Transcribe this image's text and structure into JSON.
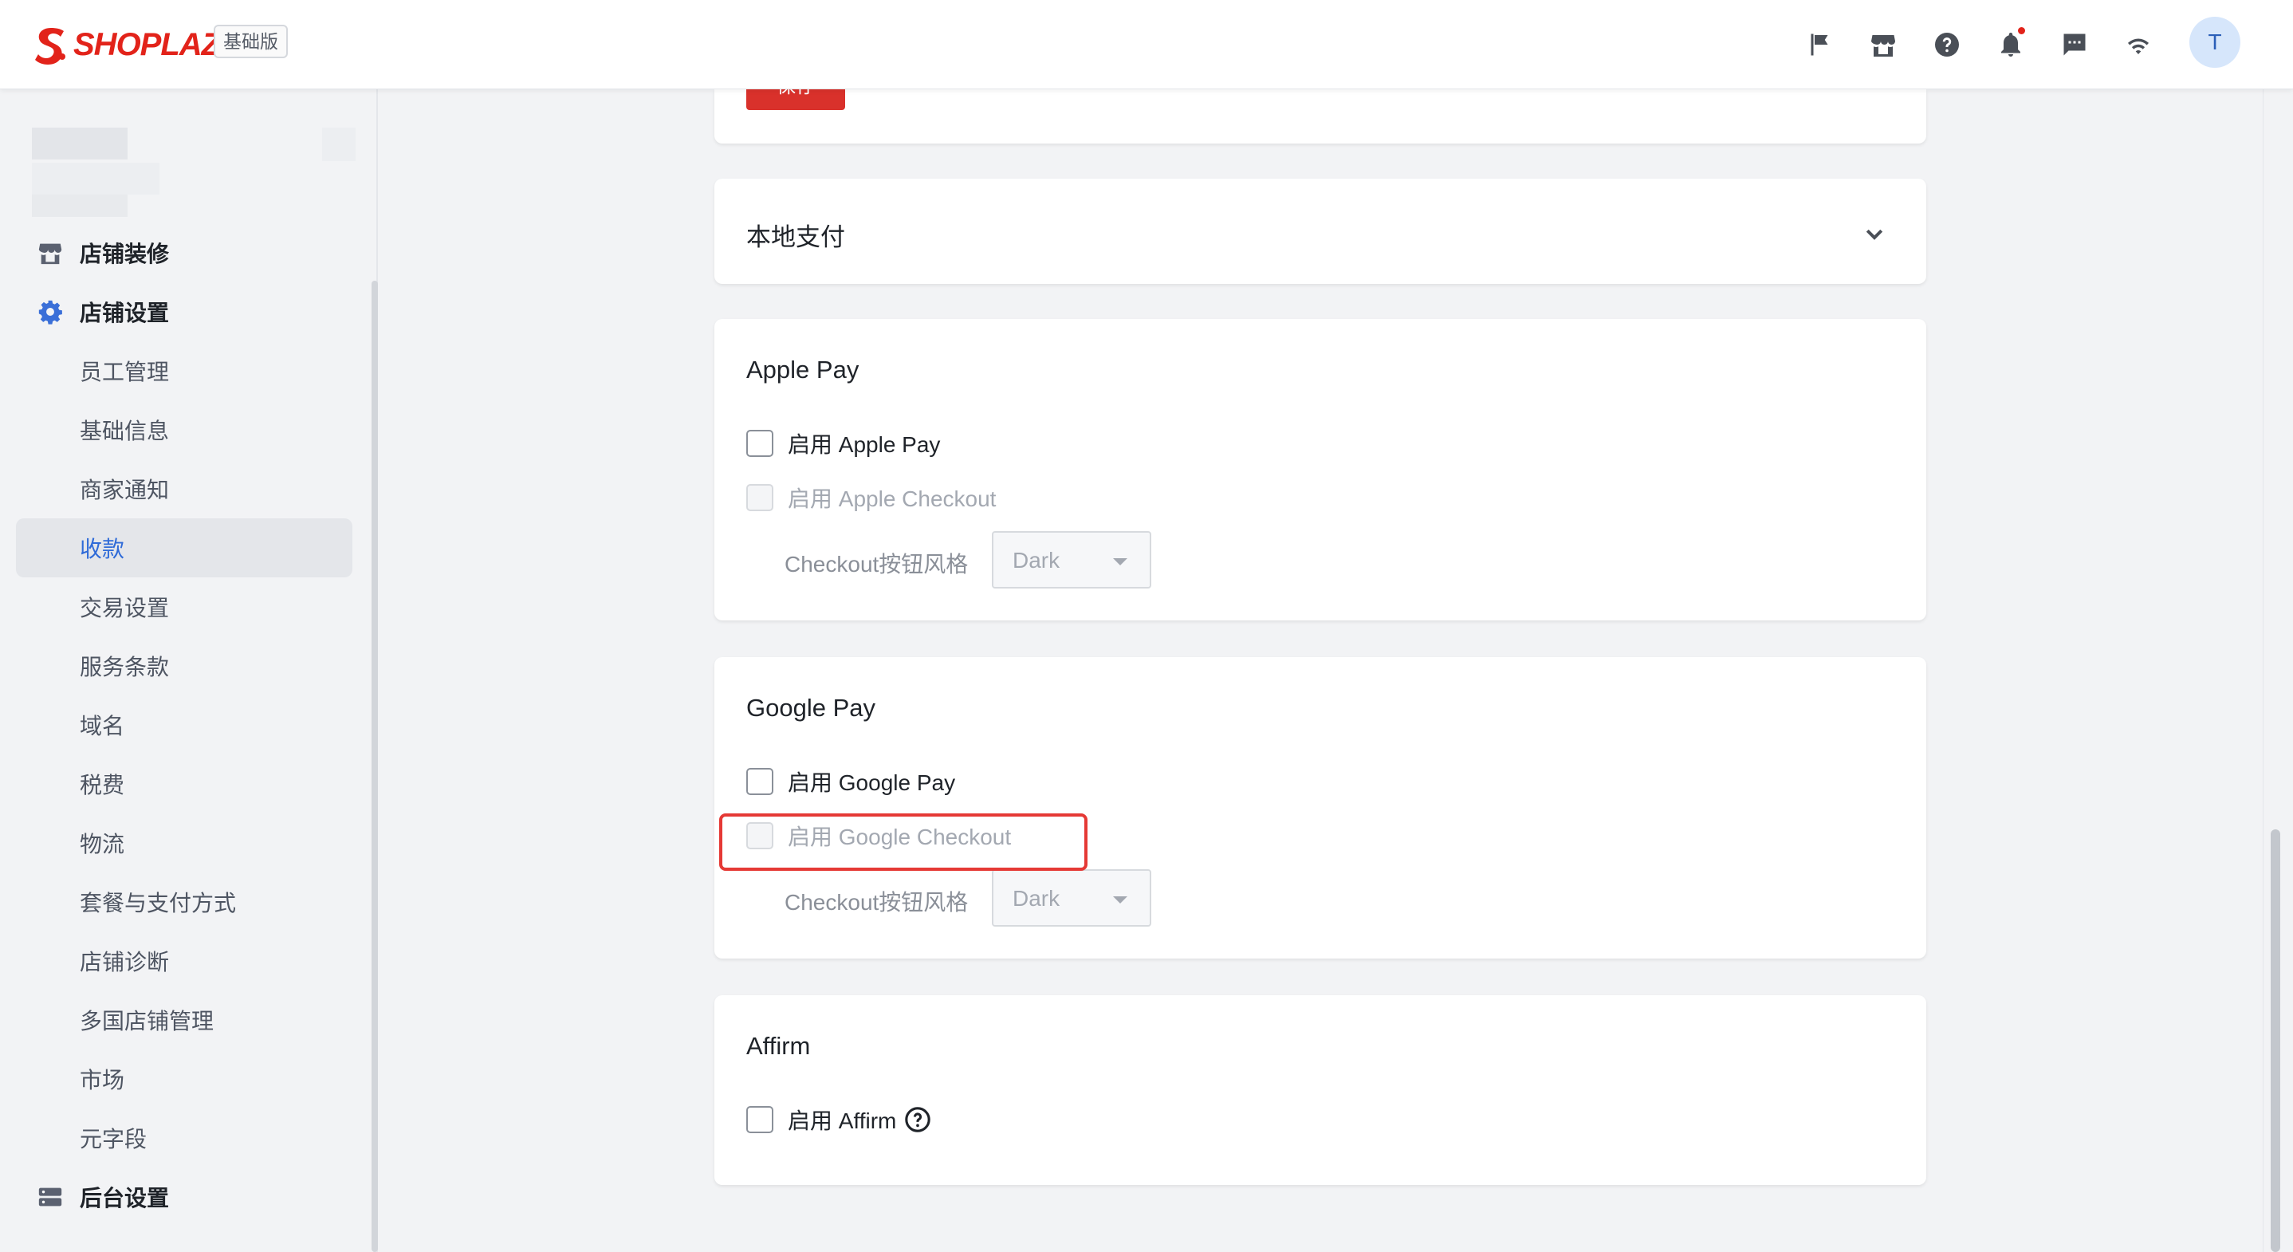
{
  "header": {
    "brand": "SHOPLAZZA",
    "plan_badge": "基础版",
    "icons": [
      "flag-icon",
      "store-icon",
      "help-icon",
      "bell-icon",
      "chat-icon",
      "wifi-icon"
    ],
    "avatar_initial": "T",
    "brand_color": "#e2231a"
  },
  "sidebar": {
    "items": [
      {
        "label": "店铺装修",
        "type": "parent",
        "icon": "store-icon"
      },
      {
        "label": "店铺设置",
        "type": "parent",
        "icon": "gear-icon"
      },
      {
        "label": "员工管理",
        "type": "sub"
      },
      {
        "label": "基础信息",
        "type": "sub"
      },
      {
        "label": "商家通知",
        "type": "sub"
      },
      {
        "label": "收款",
        "type": "sub",
        "active": true
      },
      {
        "label": "交易设置",
        "type": "sub"
      },
      {
        "label": "服务条款",
        "type": "sub"
      },
      {
        "label": "域名",
        "type": "sub"
      },
      {
        "label": "税费",
        "type": "sub"
      },
      {
        "label": "物流",
        "type": "sub"
      },
      {
        "label": "套餐与支付方式",
        "type": "sub"
      },
      {
        "label": "店铺诊断",
        "type": "sub"
      },
      {
        "label": "多国店铺管理",
        "type": "sub"
      },
      {
        "label": "市场",
        "type": "sub"
      },
      {
        "label": "元字段",
        "type": "sub"
      },
      {
        "label": "后台设置",
        "type": "parent",
        "icon": "server-icon"
      }
    ],
    "active_color": "#2f6bd8"
  },
  "main": {
    "save_button": "保存",
    "local_payment": {
      "title": "本地支付"
    },
    "apple_pay": {
      "title": "Apple Pay",
      "enable_label": "启用 Apple Pay",
      "checkout_label": "启用 Apple Checkout",
      "style_label": "Checkout按钮风格",
      "style_value": "Dark"
    },
    "google_pay": {
      "title": "Google Pay",
      "enable_label": "启用 Google Pay",
      "checkout_label": "启用 Google Checkout",
      "style_label": "Checkout按钮风格",
      "style_value": "Dark"
    },
    "affirm": {
      "title": "Affirm",
      "enable_label": "启用 Affirm"
    }
  }
}
